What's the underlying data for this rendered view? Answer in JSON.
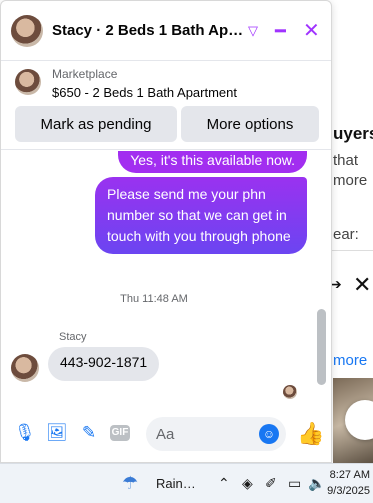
{
  "chat": {
    "title": "Stacy · 2 Beds 1 Bath Apart…",
    "listing_label": "Marketplace",
    "listing_title": "$650 - 2 Beds 1 Bath Apartment",
    "btn_pending": "Mark as pending",
    "btn_more": "More options",
    "msg_out_1": "Yes, it's this available now.",
    "msg_out_2": "Please send me your phn number so that we can get in touch with you through phone",
    "timestamp": "Thu 11:48 AM",
    "sender": "Stacy",
    "msg_in_1": "443-902-1871",
    "input_placeholder": "Aa",
    "accent": "#a033ff"
  },
  "background_page": {
    "title": "uyers",
    "line1": "that",
    "line2": "more",
    "line3": "ear:",
    "link": "more"
  },
  "taskbar": {
    "weather": "Rain…",
    "time": "8:27 AM",
    "date": "9/3/2025"
  }
}
